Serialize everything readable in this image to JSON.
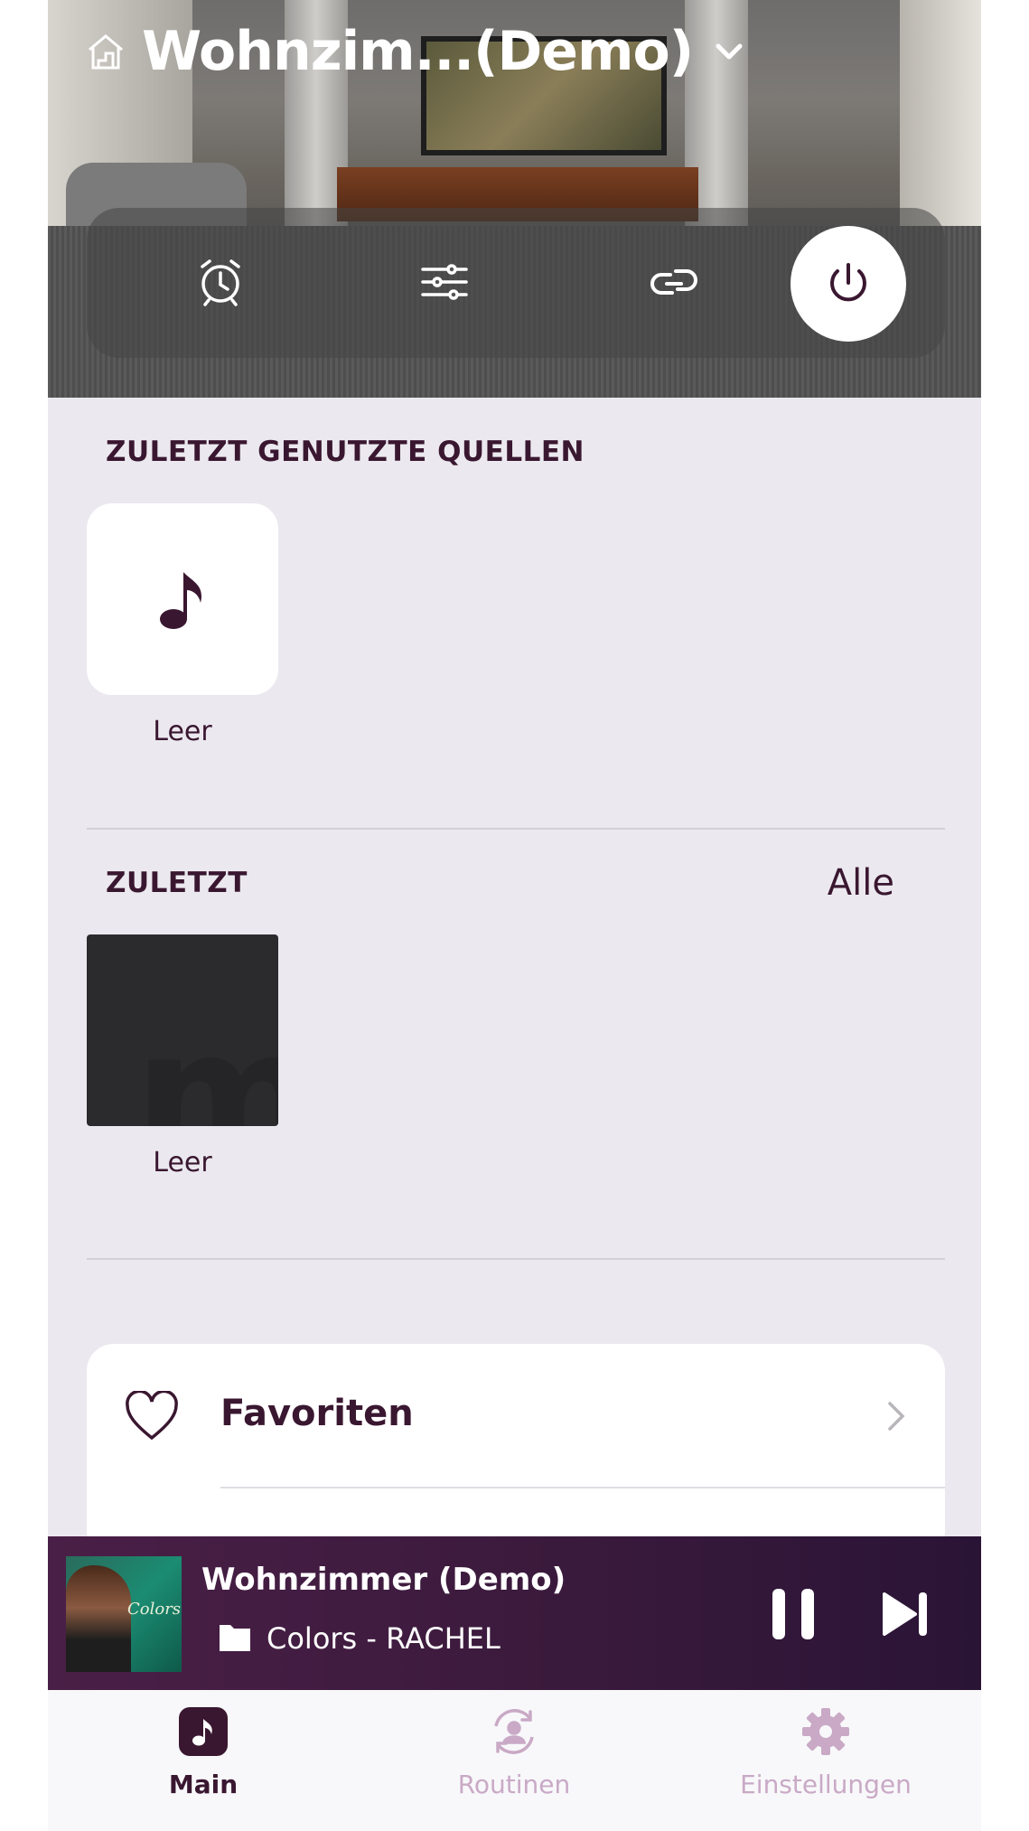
{
  "header": {
    "room_title": "Wohnzim...(Demo)",
    "icons": [
      "house-icon",
      "chevron-down-icon"
    ]
  },
  "controls": {
    "icons": [
      "alarm-icon",
      "equalizer-icon",
      "link-icon",
      "power-icon"
    ]
  },
  "recent_sources": {
    "title": "ZULETZT GENUTZTE QUELLEN",
    "items": [
      {
        "label": "Leer",
        "icon": "music-note-icon"
      }
    ]
  },
  "recent": {
    "title": "ZULETZT",
    "all_label": "Alle",
    "items": [
      {
        "label": "Leer"
      }
    ]
  },
  "favorites": {
    "label": "Favoriten",
    "icon": "heart-icon"
  },
  "player": {
    "room": "Wohnzimmer (Demo)",
    "source": "Colors - RACHEL",
    "cover_text": "Colors"
  },
  "tabs": [
    {
      "label": "Main",
      "icon": "music-note-icon",
      "active": true
    },
    {
      "label": "Routinen",
      "icon": "routine-icon",
      "active": false
    },
    {
      "label": "Einstellungen",
      "icon": "gear-icon",
      "active": false
    }
  ],
  "colors": {
    "accent": "#3a1730",
    "background": "#ebe9ef",
    "player_bg": "#3a1a3c",
    "tab_inactive": "#c9a9c6"
  }
}
